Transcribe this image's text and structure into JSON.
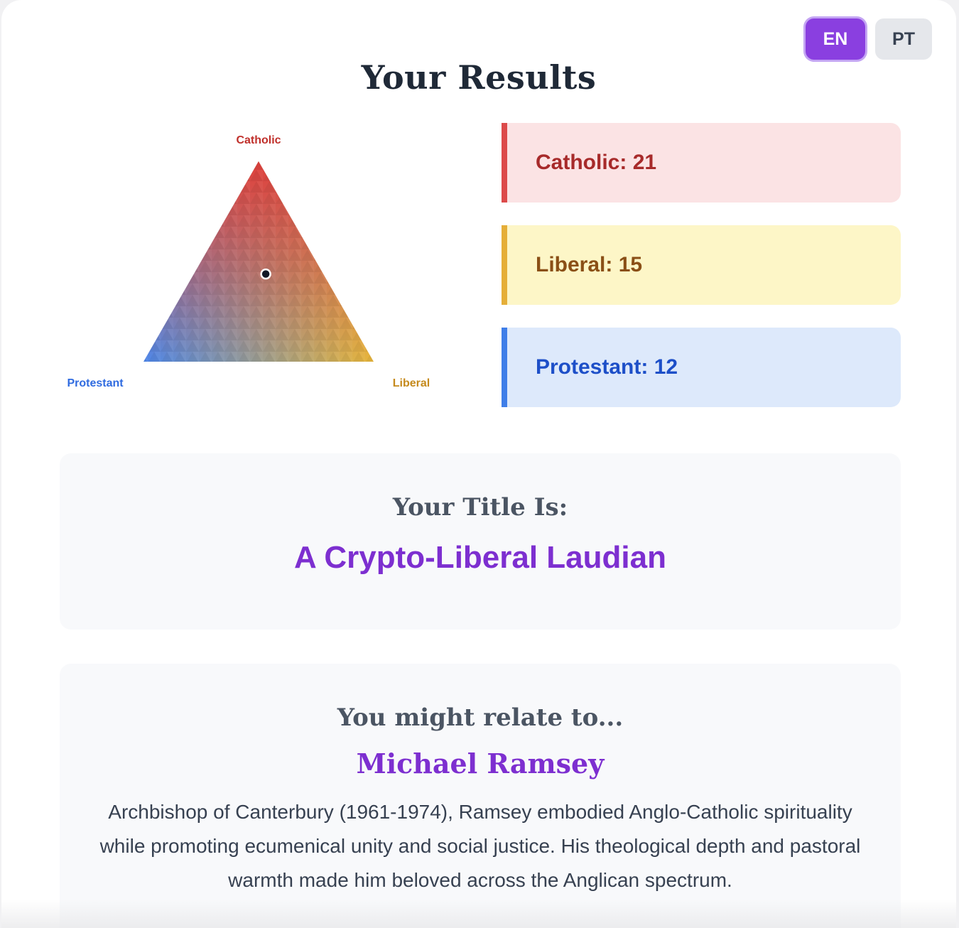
{
  "language_switch": {
    "options": [
      {
        "label": "EN",
        "active": true
      },
      {
        "label": "PT",
        "active": false
      }
    ]
  },
  "page": {
    "title": "Your Results"
  },
  "ternary": {
    "vertex_labels": {
      "top": "Catholic",
      "left": "Protestant",
      "right": "Liberal"
    },
    "colors": {
      "top": "#e0413c",
      "left": "#4d86ea",
      "right": "#e9b63a"
    },
    "weights": {
      "catholic": 21,
      "liberal": 15,
      "protestant": 12
    }
  },
  "scores": [
    {
      "label": "Catholic",
      "value": "21",
      "bg": "#fbe3e4",
      "border": "#dc4a4a",
      "color": "#a72a2a"
    },
    {
      "label": "Liberal",
      "value": "15",
      "bg": "#fdf6c7",
      "border": "#e5ae38",
      "color": "#8a4f16"
    },
    {
      "label": "Protestant",
      "value": "12",
      "bg": "#dde9fb",
      "border": "#3f7ee8",
      "color": "#1d4fc8"
    }
  ],
  "title_section": {
    "heading": "Your Title Is:",
    "value": "A Crypto-Liberal Laudian"
  },
  "relate_section": {
    "heading": "You might relate to...",
    "name": "Michael Ramsey",
    "description": "Archbishop of Canterbury (1961-1974), Ramsey embodied Anglo-Catholic spirituality while promoting ecumenical unity and social justice. His theological depth and pastoral warmth made him beloved across the Anglican spectrum."
  }
}
